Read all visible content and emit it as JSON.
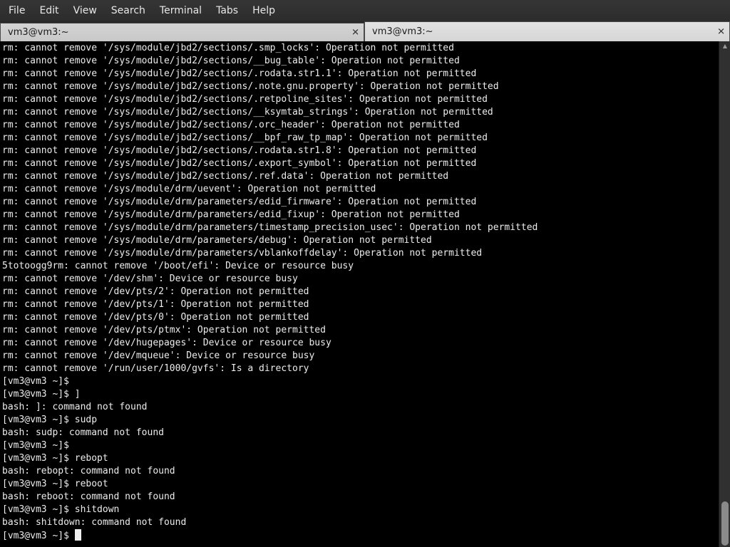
{
  "menu": {
    "items": [
      "File",
      "Edit",
      "View",
      "Search",
      "Terminal",
      "Tabs",
      "Help"
    ]
  },
  "tabs": [
    {
      "label": "vm3@vm3:~",
      "close": "✕"
    },
    {
      "label": "vm3@vm3:~",
      "close": "✕"
    }
  ],
  "terminal": {
    "lines": [
      "rm: cannot remove '/sys/module/jbd2/sections/.smp_locks': Operation not permitted",
      "rm: cannot remove '/sys/module/jbd2/sections/__bug_table': Operation not permitted",
      "rm: cannot remove '/sys/module/jbd2/sections/.rodata.str1.1': Operation not permitted",
      "rm: cannot remove '/sys/module/jbd2/sections/.note.gnu.property': Operation not permitted",
      "rm: cannot remove '/sys/module/jbd2/sections/.retpoline_sites': Operation not permitted",
      "rm: cannot remove '/sys/module/jbd2/sections/__ksymtab_strings': Operation not permitted",
      "rm: cannot remove '/sys/module/jbd2/sections/.orc_header': Operation not permitted",
      "rm: cannot remove '/sys/module/jbd2/sections/__bpf_raw_tp_map': Operation not permitted",
      "rm: cannot remove '/sys/module/jbd2/sections/.rodata.str1.8': Operation not permitted",
      "rm: cannot remove '/sys/module/jbd2/sections/.export_symbol': Operation not permitted",
      "rm: cannot remove '/sys/module/jbd2/sections/.ref.data': Operation not permitted",
      "rm: cannot remove '/sys/module/drm/uevent': Operation not permitted",
      "rm: cannot remove '/sys/module/drm/parameters/edid_firmware': Operation not permitted",
      "rm: cannot remove '/sys/module/drm/parameters/edid_fixup': Operation not permitted",
      "rm: cannot remove '/sys/module/drm/parameters/timestamp_precision_usec': Operation not permitted",
      "rm: cannot remove '/sys/module/drm/parameters/debug': Operation not permitted",
      "rm: cannot remove '/sys/module/drm/parameters/vblankoffdelay': Operation not permitted",
      "5totoogg9rm: cannot remove '/boot/efi': Device or resource busy",
      "rm: cannot remove '/dev/shm': Device or resource busy",
      "rm: cannot remove '/dev/pts/2': Operation not permitted",
      "rm: cannot remove '/dev/pts/1': Operation not permitted",
      "rm: cannot remove '/dev/pts/0': Operation not permitted",
      "rm: cannot remove '/dev/pts/ptmx': Operation not permitted",
      "rm: cannot remove '/dev/hugepages': Device or resource busy",
      "rm: cannot remove '/dev/mqueue': Device or resource busy",
      "rm: cannot remove '/run/user/1000/gvfs': Is a directory",
      "[vm3@vm3 ~]$",
      "[vm3@vm3 ~]$ ]",
      "bash: ]: command not found",
      "[vm3@vm3 ~]$ sudp",
      "bash: sudp: command not found",
      "[vm3@vm3 ~]$",
      "[vm3@vm3 ~]$ rebopt",
      "bash: rebopt: command not found",
      "[vm3@vm3 ~]$ reboot",
      "bash: reboot: command not found",
      "[vm3@vm3 ~]$ shitdown",
      "bash: shitdown: command not found"
    ],
    "prompt": "[vm3@vm3 ~]$ "
  },
  "scrollbar": {
    "position_fraction": 1.0
  }
}
